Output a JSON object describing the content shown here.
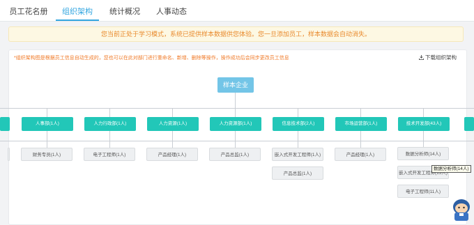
{
  "tabs": [
    {
      "label": "员工花名册",
      "active": false
    },
    {
      "label": "组织架构",
      "active": true
    },
    {
      "label": "统计概况",
      "active": false
    },
    {
      "label": "人事动态",
      "active": false
    }
  ],
  "notice": "您当前正处于学习模式，系统已提供样本数据供您体验。您一旦添加员工，样本数据会自动消失。",
  "hint": "*组织架构图是根据员工信息自动生成的，您也可以在此对部门进行重命名、新增、删除等操作，操作成功后会同步更改员工信息",
  "download_label": "下载组织架构",
  "root": "样本企业",
  "departments": [
    "人事部(1人)",
    "人力行政部(1人)",
    "人力资源(1人)",
    "人力资源部(1人)",
    "信息技术部(2人)",
    "市场运营部(1人)",
    "技术开发部(43人)"
  ],
  "positions": {
    "hr": [
      "财务专员(1人)"
    ],
    "admin": [
      "电子工程师(1人)"
    ],
    "resources": [
      "产品经理(1人)"
    ],
    "resources_dept": [
      "产品总监(1人)"
    ],
    "it": [
      "嵌入式开发工程师(1人)",
      "产品总监(1人)"
    ],
    "marketing": [
      "产品经理(1人)"
    ],
    "tech": [
      "数据分析师(14人)",
      "嵌入式开发工程师(13人)",
      "电子工程师(11人)"
    ]
  },
  "tooltip": "数据分析师(14人)",
  "colors": {
    "accent": "#33a6e0",
    "dept": "#22c7b8",
    "root": "#73c5e7",
    "warning": "#e98a2d"
  },
  "icons": {
    "download": "download-icon",
    "mascot": "mascot-icon"
  }
}
